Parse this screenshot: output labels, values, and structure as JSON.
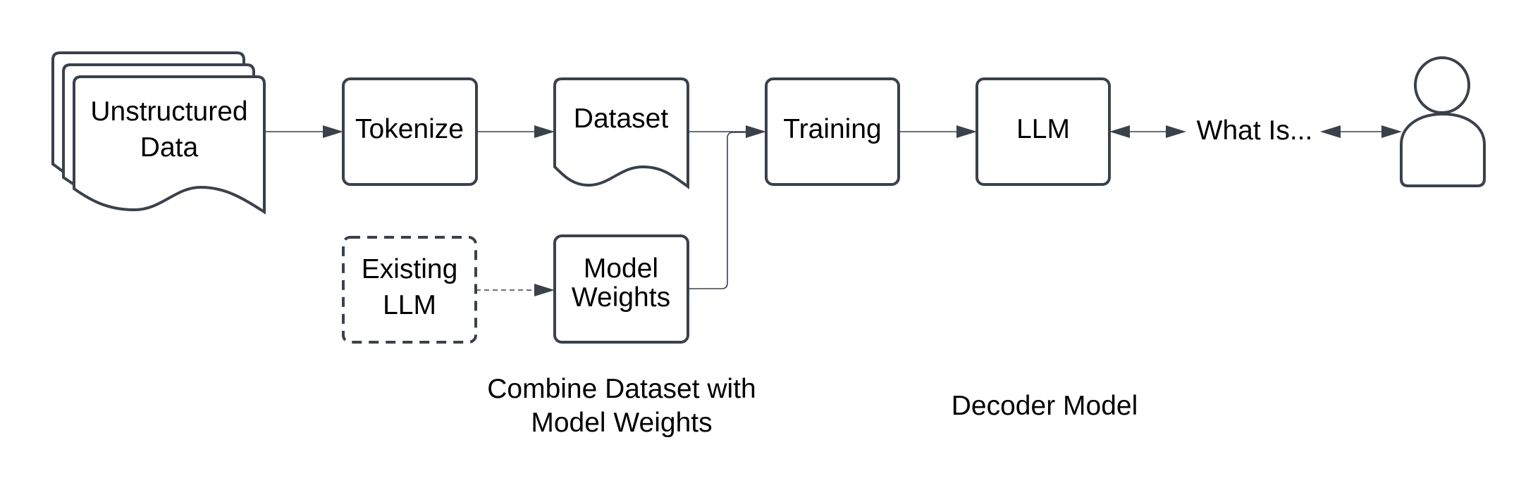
{
  "diagram": {
    "nodes": {
      "unstructured_data": {
        "lines": [
          "Unstructured",
          "Data"
        ],
        "shape": "multi-document"
      },
      "tokenize": {
        "lines": [
          "Tokenize"
        ],
        "shape": "rounded-rectangle"
      },
      "dataset": {
        "lines": [
          "Dataset"
        ],
        "shape": "document"
      },
      "existing_llm": {
        "lines": [
          "Existing",
          "LLM"
        ],
        "shape": "dashed-rounded-rectangle"
      },
      "model_weights": {
        "lines": [
          "Model",
          "Weights"
        ],
        "shape": "rounded-rectangle"
      },
      "training": {
        "lines": [
          "Training"
        ],
        "shape": "rounded-rectangle"
      },
      "llm": {
        "lines": [
          "LLM"
        ],
        "shape": "rounded-rectangle"
      },
      "query_label": {
        "lines": [
          "What Is..."
        ],
        "shape": "text"
      },
      "user": {
        "lines": [],
        "shape": "person-icon"
      }
    },
    "edges": [
      {
        "from": "unstructured_data",
        "to": "tokenize",
        "style": "solid",
        "direction": "forward"
      },
      {
        "from": "tokenize",
        "to": "dataset",
        "style": "solid",
        "direction": "forward"
      },
      {
        "from": "dataset",
        "to": "training",
        "style": "solid",
        "direction": "forward"
      },
      {
        "from": "existing_llm",
        "to": "model_weights",
        "style": "dashed",
        "direction": "forward"
      },
      {
        "from": "model_weights",
        "to": "training",
        "style": "solid",
        "direction": "forward"
      },
      {
        "from": "training",
        "to": "llm",
        "style": "solid",
        "direction": "forward"
      },
      {
        "from": "llm",
        "to": "query_label",
        "style": "solid",
        "direction": "both"
      },
      {
        "from": "query_label",
        "to": "user",
        "style": "solid",
        "direction": "both"
      }
    ],
    "captions": {
      "combine": [
        "Combine Dataset with",
        "Model Weights"
      ],
      "decoder": [
        "Decoder Model"
      ]
    },
    "colors": {
      "stroke": "#3a414a",
      "text": "#000000",
      "background": "#ffffff"
    }
  }
}
